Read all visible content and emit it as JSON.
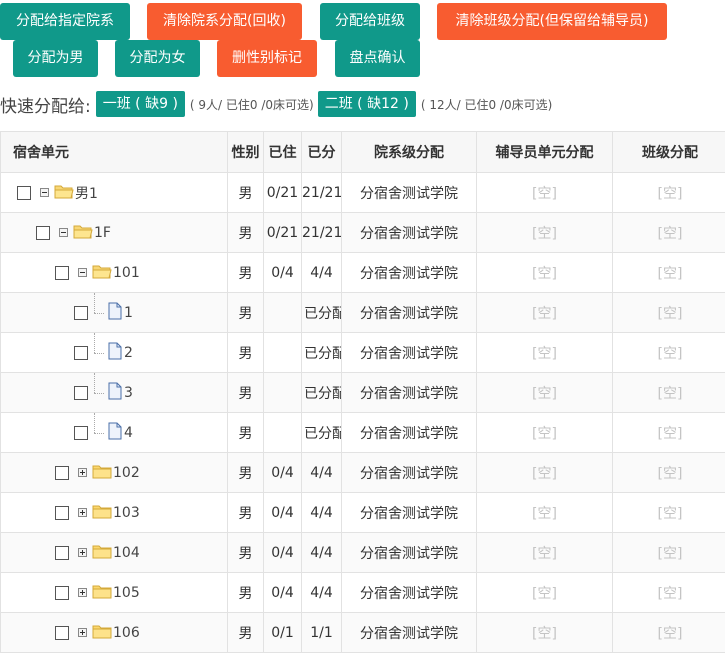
{
  "toolbar": {
    "row1": [
      {
        "label": "分配给指定院系",
        "color": "teal"
      },
      {
        "label": "清除院系分配(回收)",
        "color": "orange"
      },
      {
        "label": "分配给班级",
        "color": "teal"
      },
      {
        "label": "清除班级分配(但保留给辅导员)",
        "color": "orange"
      }
    ],
    "row2": [
      {
        "label": "分配为男",
        "color": "teal"
      },
      {
        "label": "分配为女",
        "color": "teal"
      },
      {
        "label": "删性别标记",
        "color": "orange"
      },
      {
        "label": "盘点确认",
        "color": "teal"
      }
    ]
  },
  "quick_assign": {
    "label": "快速分配给:",
    "classes": [
      {
        "name": "一班 ( 缺9 )",
        "info": "( 9人/ 已住0 /0床可选)"
      },
      {
        "name": "二班 ( 缺12 )",
        "info": "( 12人/ 已住0 /0床可选)"
      }
    ]
  },
  "table": {
    "headers": [
      "宿舍单元",
      "性别",
      "已住",
      "已分",
      "院系级分配",
      "辅导员单元分配",
      "班级分配"
    ],
    "rows": [
      {
        "label": "男1",
        "gender": "男",
        "occupied": "0/21",
        "assigned": "21/21",
        "dept": "分宿舍测试学院",
        "counselor": "[空]",
        "class": "[空]",
        "level": 0,
        "node": "folder-open"
      },
      {
        "label": "1F",
        "gender": "男",
        "occupied": "0/21",
        "assigned": "21/21",
        "dept": "分宿舍测试学院",
        "counselor": "[空]",
        "class": "[空]",
        "level": 1,
        "node": "folder-open"
      },
      {
        "label": "101",
        "gender": "男",
        "occupied": "0/4",
        "assigned": "4/4",
        "dept": "分宿舍测试学院",
        "counselor": "[空]",
        "class": "[空]",
        "level": 2,
        "node": "folder-open"
      },
      {
        "label": "1",
        "gender": "男",
        "occupied": "",
        "assigned": "已分配",
        "dept": "分宿舍测试学院",
        "counselor": "[空]",
        "class": "[空]",
        "level": 3,
        "node": "file"
      },
      {
        "label": "2",
        "gender": "男",
        "occupied": "",
        "assigned": "已分配",
        "dept": "分宿舍测试学院",
        "counselor": "[空]",
        "class": "[空]",
        "level": 3,
        "node": "file"
      },
      {
        "label": "3",
        "gender": "男",
        "occupied": "",
        "assigned": "已分配",
        "dept": "分宿舍测试学院",
        "counselor": "[空]",
        "class": "[空]",
        "level": 3,
        "node": "file"
      },
      {
        "label": "4",
        "gender": "男",
        "occupied": "",
        "assigned": "已分配",
        "dept": "分宿舍测试学院",
        "counselor": "[空]",
        "class": "[空]",
        "level": 3,
        "node": "file"
      },
      {
        "label": "102",
        "gender": "男",
        "occupied": "0/4",
        "assigned": "4/4",
        "dept": "分宿舍测试学院",
        "counselor": "[空]",
        "class": "[空]",
        "level": 2,
        "node": "folder-closed"
      },
      {
        "label": "103",
        "gender": "男",
        "occupied": "0/4",
        "assigned": "4/4",
        "dept": "分宿舍测试学院",
        "counselor": "[空]",
        "class": "[空]",
        "level": 2,
        "node": "folder-closed"
      },
      {
        "label": "104",
        "gender": "男",
        "occupied": "0/4",
        "assigned": "4/4",
        "dept": "分宿舍测试学院",
        "counselor": "[空]",
        "class": "[空]",
        "level": 2,
        "node": "folder-closed"
      },
      {
        "label": "105",
        "gender": "男",
        "occupied": "0/4",
        "assigned": "4/4",
        "dept": "分宿舍测试学院",
        "counselor": "[空]",
        "class": "[空]",
        "level": 2,
        "node": "folder-closed"
      },
      {
        "label": "106",
        "gender": "男",
        "occupied": "0/1",
        "assigned": "1/1",
        "dept": "分宿舍测试学院",
        "counselor": "[空]",
        "class": "[空]",
        "level": 2,
        "node": "folder-closed"
      }
    ]
  }
}
